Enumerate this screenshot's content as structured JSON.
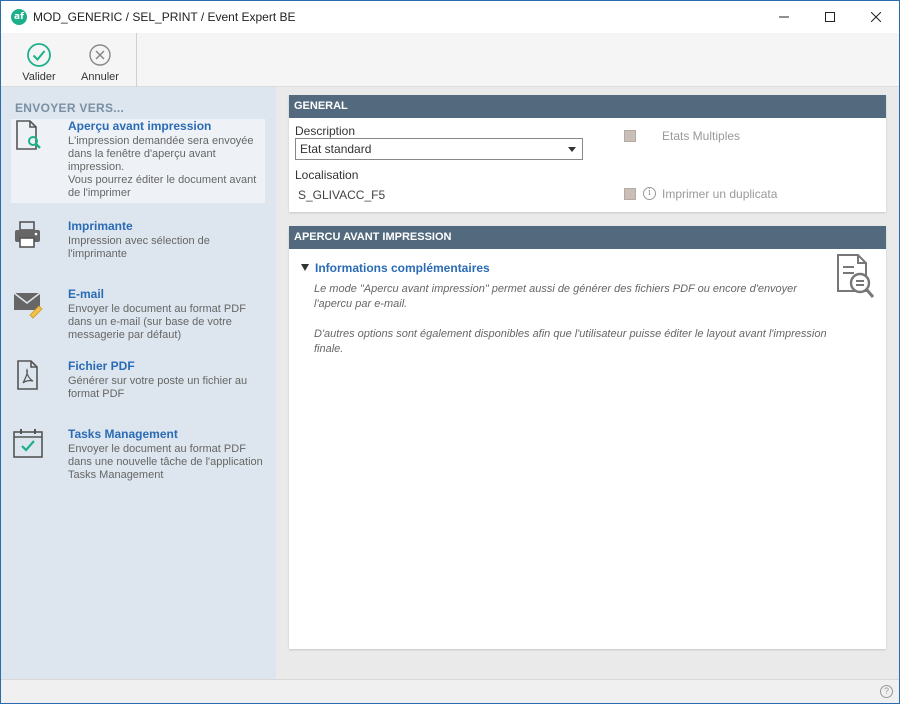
{
  "window": {
    "logo_text": "af",
    "title": "MOD_GENERIC / SEL_PRINT / Event Expert BE",
    "minimize": "—",
    "maximize": "☐",
    "close": "✕"
  },
  "toolbar": {
    "validate_label": "Valider",
    "cancel_label": "Annuler"
  },
  "sidebar": {
    "title": "ENVOYER VERS...",
    "items": [
      {
        "title": "Aperçu avant impression",
        "desc": "L'impression demandée sera envoyée dans la fenêtre d'aperçu avant impression.\nVous pourrez éditer le document avant de l'imprimer",
        "icon": "print-preview-icon",
        "selected": true
      },
      {
        "title": "Imprimante",
        "desc": "Impression avec sélection de l'imprimante",
        "icon": "printer-icon",
        "selected": false
      },
      {
        "title": "E-mail",
        "desc": "Envoyer le document au format PDF dans un e-mail (sur base de votre messagerie par défaut)",
        "icon": "email-icon",
        "selected": false
      },
      {
        "title": "Fichier PDF",
        "desc": "Générer sur votre poste un fichier au format PDF",
        "icon": "pdf-file-icon",
        "selected": false
      },
      {
        "title": "Tasks Management",
        "desc": "Envoyer le document au format PDF dans une nouvelle tâche de l'application Tasks Management",
        "icon": "calendar-check-icon",
        "selected": false
      }
    ]
  },
  "general": {
    "header": "GENERAL",
    "description_label": "Description",
    "description_value": "Etat standard",
    "localisation_label": "Localisation",
    "localisation_value": "S_GLIVACC_F5",
    "multi_states_label": "Etats Multiples",
    "duplicate_label": "Imprimer un duplicata"
  },
  "preview": {
    "header": "APERCU AVANT IMPRESSION",
    "info_title": "Informations complémentaires",
    "info_p1": "Le mode \"Apercu avant impression\" permet aussi de générer des fichiers PDF ou encore d'envoyer l'apercu par e-mail.",
    "info_p2": "D'autres options sont également disponibles afin que l'utilisateur puisse éditer le layout avant l'impression finale."
  },
  "colors": {
    "accent": "#2a6bb5",
    "panel_header": "#536a7e",
    "sidebar_bg": "#dde6ee",
    "ok_green": "#1cb08a"
  }
}
